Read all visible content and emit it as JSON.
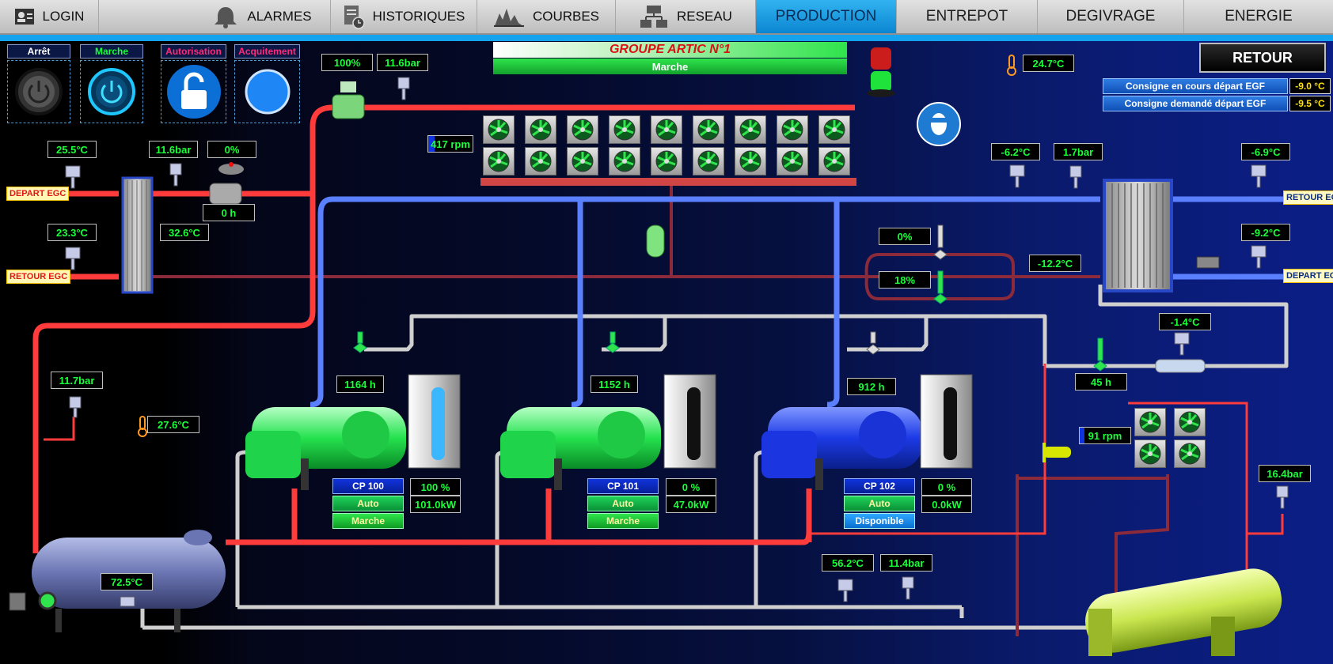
{
  "nav": {
    "tabs": [
      {
        "label": "LOGIN",
        "icon": "login-icon"
      },
      {
        "label": "ALARMES",
        "icon": "bell-icon"
      },
      {
        "label": "HISTORIQUES",
        "icon": "history-icon"
      },
      {
        "label": "COURBES",
        "icon": "chart-icon"
      },
      {
        "label": "RESEAU",
        "icon": "network-icon"
      },
      {
        "label": "PRODUCTION",
        "active": true
      },
      {
        "label": "ENTREPOT"
      },
      {
        "label": "DEGIVRAGE"
      },
      {
        "label": "ENERGIE"
      }
    ]
  },
  "controls": {
    "stop": "Arrêt",
    "start": "Marche",
    "authorization": "Autorisation",
    "acknowledge": "Acquitement"
  },
  "group": {
    "title": "GROUPE ARTIC N°1",
    "status": "Marche"
  },
  "retour_button": "RETOUR",
  "setpoints": {
    "current_label": "Consigne en cours départ EGF",
    "current_value": "-9.0 °C",
    "requested_label": "Consigne demandé départ EGF",
    "requested_value": "-9.5 °C"
  },
  "tags": {
    "depart_egc": "DEPART EGC",
    "retour_egc": "RETOUR EGC",
    "retour_egf": "RETOUR EGF",
    "depart_egf": "DEPART EGF"
  },
  "values": {
    "valve_top_pct": "100%",
    "valve_top_bar": "11.6bar",
    "ambient_top": "24.7°C",
    "fan_rpm": "417 rpm",
    "egc_depart_temp": "25.5°C",
    "egc_bar": "11.6bar",
    "egc_valve_pct": "0%",
    "egc_hours": "0 h",
    "egc_retour_temp": "23.3°C",
    "egc_hx_temp": "32.6°C",
    "egf_retour_temp": "-6.2°C",
    "egf_retour_bar": "1.7bar",
    "egf_out_temp_1": "-6.9°C",
    "egf_valve_a": "0%",
    "egf_valve_b": "18%",
    "egf_suction_temp": "-12.2°C",
    "egf_depart_temp": "-9.2°C",
    "econ_temp": "-1.4°C",
    "econ_hours": "45 h",
    "liquid_bar": "11.7bar",
    "room_temp": "27.6°C",
    "small_fan_rpm": "91 rpm",
    "cond_bar": "16.4bar",
    "receiver_temp": "72.5°C",
    "discharge_temp": "56.2°C",
    "discharge_bar": "11.4bar"
  },
  "compressors": [
    {
      "hours": "1164 h",
      "name": "CP 100",
      "load": "100 %",
      "mode": "Auto",
      "power": "101.0kW",
      "state": "Marche",
      "color": "#19e64a"
    },
    {
      "hours": "1152 h",
      "name": "CP 101",
      "load": "0 %",
      "mode": "Auto",
      "power": "47.0kW",
      "state": "Marche",
      "color": "#19e64a"
    },
    {
      "hours": "912 h",
      "name": "CP 102",
      "load": "0 %",
      "mode": "Auto",
      "power": "0.0kW",
      "state": "Disponible",
      "color": "#1533e6"
    }
  ],
  "colors": {
    "hot_pipe": "#ff3b3b",
    "cold_pipe": "#4d78ff",
    "grey_pipe": "#cfcfcf",
    "dark_red_pipe": "#8b2a3a",
    "value_text": "#19ff3a"
  }
}
